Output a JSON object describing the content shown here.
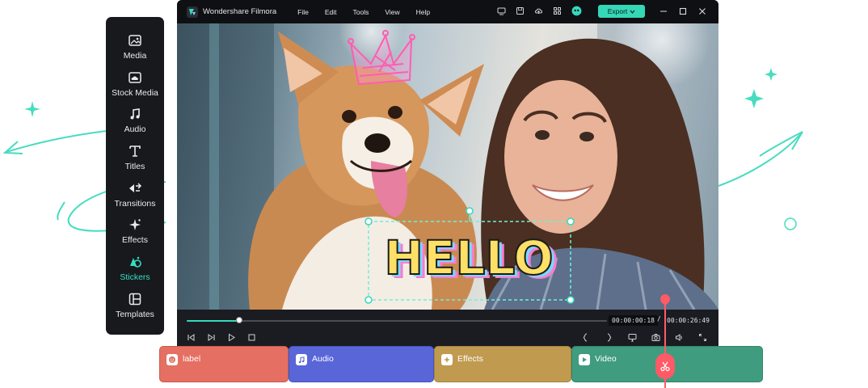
{
  "sidebar": {
    "items": [
      {
        "label": "Media",
        "icon": "image-icon"
      },
      {
        "label": "Stock Media",
        "icon": "cloud-icon"
      },
      {
        "label": "Audio",
        "icon": "music-note-icon"
      },
      {
        "label": "Titles",
        "icon": "text-t-icon"
      },
      {
        "label": "Transitions",
        "icon": "transition-icon"
      },
      {
        "label": "Effects",
        "icon": "sparkle-icon"
      },
      {
        "label": "Stickers",
        "icon": "sticker-icon",
        "active": true
      },
      {
        "label": "Templates",
        "icon": "template-icon"
      }
    ]
  },
  "window": {
    "app_title": "Wondershare Filmora",
    "menu": [
      "File",
      "Edit",
      "Tools",
      "View",
      "Help"
    ],
    "export_label": "Export"
  },
  "preview": {
    "sticker_text": "HELLO"
  },
  "playback": {
    "current_time": "00:00:00:18",
    "separator": "/",
    "total_time": "00:00:26:49",
    "progress": 0.125
  },
  "timeline": {
    "tracks": [
      {
        "label": "label",
        "icon": "sticker-face-icon"
      },
      {
        "label": "Audio",
        "icon": "music-note-icon"
      },
      {
        "label": "Effects",
        "icon": "sparkle-icon"
      },
      {
        "label": "Video",
        "icon": "play-icon"
      }
    ]
  },
  "colors": {
    "accent": "#35d9bd",
    "sidebar_bg": "#17191d",
    "window_bg": "#1a1c21",
    "label_track": "#e46f62",
    "audio_track": "#5866d8",
    "effects_track": "#c09a4f",
    "video_track": "#3f9c7f",
    "playhead": "#ff5a66"
  }
}
